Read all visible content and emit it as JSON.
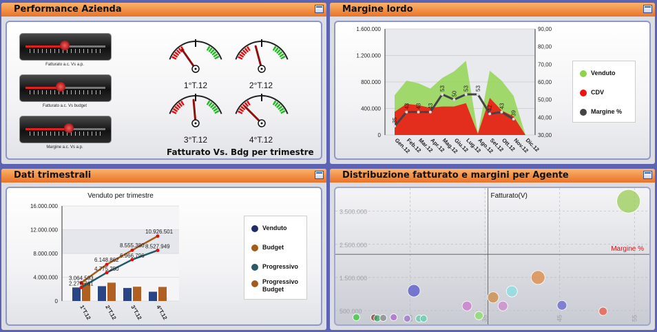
{
  "panels": {
    "performance": {
      "title": "Performance Azienda",
      "sliders": [
        {
          "label": "Fatturato a.c. Vs a.p.",
          "level": 0.5
        },
        {
          "label": "Fatturato a.c. Vs budget",
          "level": 0.45
        },
        {
          "label": "Margine a.c. Vs a.p.",
          "level": 0.55
        }
      ],
      "gauges": [
        {
          "label": "1°T.12"
        },
        {
          "label": "2°T.12"
        },
        {
          "label": "3°T.12"
        },
        {
          "label": "4°T.12"
        }
      ],
      "gauges_caption": "Fatturato Vs. Bdg per trimestre"
    },
    "margine": {
      "title": "Margine lordo",
      "legend": [
        "Venduto",
        "CDV",
        "Margine %"
      ]
    },
    "trimestrali": {
      "title": "Dati trimestrali",
      "legend": [
        "Venduto",
        "Budget",
        "Progressivo",
        "Progressivo Budget"
      ]
    },
    "distribuzione": {
      "title": "Distribuzione fatturato e margini per Agente",
      "ylabel": "Fatturato(V)",
      "xlabel": "Margine %"
    }
  },
  "colors": {
    "venduto": "#8fd34b",
    "cdv": "#ee1111",
    "margine": "#444444",
    "bar_blue": "#27407a",
    "bar_orange": "#b06020",
    "prog": "#cc1111"
  },
  "chart_data": [
    {
      "type": "area",
      "title": "Margine lordo",
      "categories": [
        "Gen.12",
        "Feb.12",
        "Mar.12",
        "Apr.12",
        "Mag.12",
        "Giu.12",
        "Lug.12",
        "Ago.12",
        "Set.12",
        "Ott.12",
        "Nov.12",
        "Dic.12"
      ],
      "y_left_ticks": [
        "1.600.000",
        "1.200.000",
        "800.000",
        "400.000",
        "0"
      ],
      "y_right_ticks": [
        "90,00",
        "80,00",
        "70,00",
        "60,00",
        "50,00",
        "40,00",
        "30,00"
      ],
      "ylim": [
        0,
        1600000
      ],
      "y2lim": [
        30,
        90
      ],
      "series": [
        {
          "name": "Venduto",
          "values": [
            600000,
            820000,
            780000,
            700000,
            860000,
            960000,
            1120000,
            30000,
            970000,
            820000,
            590000,
            0
          ]
        },
        {
          "name": "CDV",
          "values": [
            350000,
            470000,
            450000,
            410000,
            430000,
            430000,
            480000,
            20000,
            560000,
            370000,
            280000,
            0
          ]
        },
        {
          "name": "Margine %",
          "values": [
            35,
            43,
            43,
            43,
            53,
            50,
            53,
            53,
            42,
            43,
            39,
            null
          ]
        }
      ]
    },
    {
      "type": "bar",
      "title": "Venduto per trimestre",
      "categories": [
        "1°T.12",
        "2°T.12",
        "3°T.12",
        "4°T.12"
      ],
      "y_ticks": [
        "16.000.000",
        "12.000.000",
        "8.000.000",
        "4.000.000",
        "0"
      ],
      "ylim": [
        0,
        16000000
      ],
      "series": [
        {
          "name": "Venduto",
          "values": [
            2276761,
            2498489,
            2191546,
            1561151
          ]
        },
        {
          "name": "Budget",
          "values": [
            3064593,
            3084269,
            2406580,
            2371121
          ]
        },
        {
          "name": "Progressivo",
          "values": [
            2276761,
            4775250,
            6966796,
            8527949
          ]
        },
        {
          "name": "Progressivo Budget",
          "values": [
            3064593,
            6148862,
            8555380,
            10926501
          ]
        }
      ],
      "labels_budget": [
        "3.064.593",
        "6.148.862",
        "8.555.380",
        "10.926.501"
      ],
      "labels_prog": [
        "2.276.761",
        "4.775.250",
        "6.966.796",
        "8.527.949"
      ]
    },
    {
      "type": "scatter",
      "title": "Distribuzione fatturato e margini per Agente",
      "y_ticks": [
        "3.500.000",
        "2.500.000",
        "1.500.000",
        "500.000"
      ],
      "x_ticks": [
        "25",
        "35",
        "45",
        "55"
      ],
      "xlim": [
        15,
        57
      ],
      "ylim": [
        0,
        4200000
      ],
      "points": [
        {
          "x": 17.8,
          "y": 300000,
          "r": 5,
          "c": "#33cc33"
        },
        {
          "x": 20.2,
          "y": 290000,
          "r": 5,
          "c": "#993333"
        },
        {
          "x": 20.6,
          "y": 270000,
          "r": 5,
          "c": "#33aa66"
        },
        {
          "x": 21.4,
          "y": 280000,
          "r": 5,
          "c": "#888888"
        },
        {
          "x": 22.8,
          "y": 300000,
          "r": 5,
          "c": "#aa66cc"
        },
        {
          "x": 24.6,
          "y": 260000,
          "r": 5,
          "c": "#9977cc"
        },
        {
          "x": 25.5,
          "y": 1100000,
          "r": 9,
          "c": "#5555cc"
        },
        {
          "x": 26.2,
          "y": 260000,
          "r": 5,
          "c": "#66ccaa"
        },
        {
          "x": 26.8,
          "y": 260000,
          "r": 5,
          "c": "#66ccaa"
        },
        {
          "x": 32.6,
          "y": 640000,
          "r": 7,
          "c": "#cc77cc"
        },
        {
          "x": 34.2,
          "y": 350000,
          "r": 6,
          "c": "#88dd66"
        },
        {
          "x": 36.1,
          "y": 900000,
          "r": 8,
          "c": "#cc8844"
        },
        {
          "x": 37.4,
          "y": 640000,
          "r": 7,
          "c": "#cc88cc"
        },
        {
          "x": 38.6,
          "y": 1080000,
          "r": 8,
          "c": "#88dddd"
        },
        {
          "x": 42.1,
          "y": 1500000,
          "r": 10,
          "c": "#dd8844"
        },
        {
          "x": 45.3,
          "y": 660000,
          "r": 7,
          "c": "#6666cc"
        },
        {
          "x": 50.8,
          "y": 480000,
          "r": 6,
          "c": "#ee5544"
        },
        {
          "x": 54.2,
          "y": 3800000,
          "r": 17,
          "c": "#99cc55"
        }
      ]
    }
  ]
}
